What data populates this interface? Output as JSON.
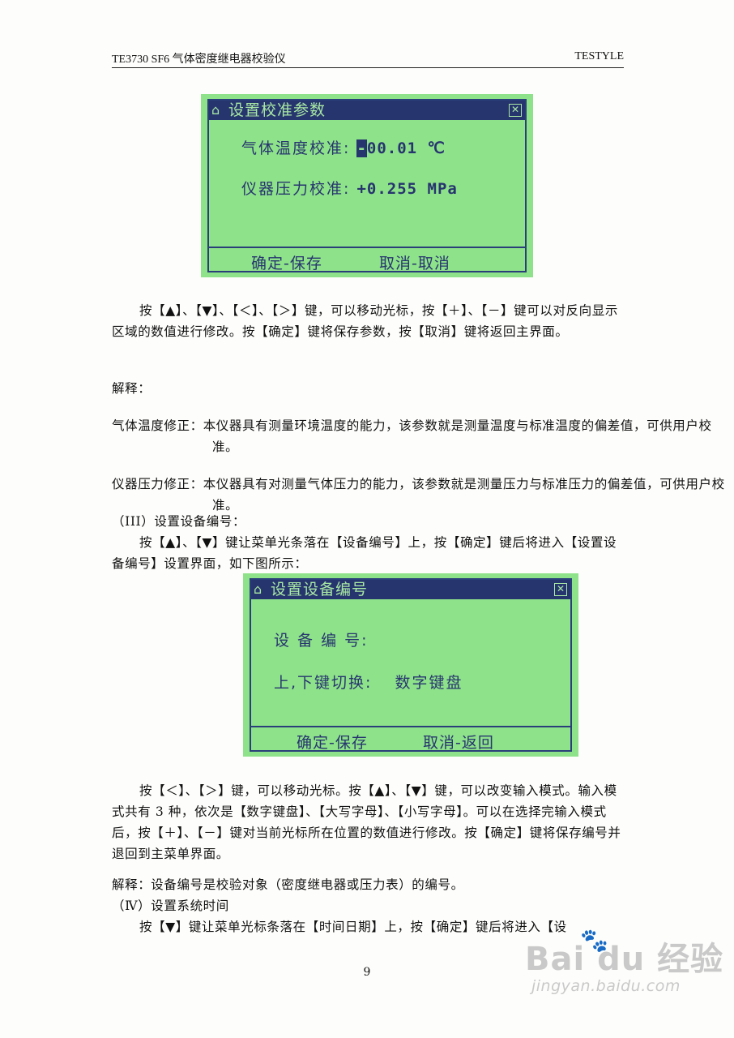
{
  "header": {
    "left": "TE3730 SF6 气体密度继电器校验仪",
    "right": "TESTYLE"
  },
  "screen1": {
    "title": "设置校准参数",
    "temp_label": "气体温度校准:",
    "temp_cursor": "-",
    "temp_value": "00.01 ℃",
    "pressure_label": "仪器压力校准:",
    "pressure_value": "+0.255 MPa",
    "btn_confirm": "确定-保存",
    "btn_cancel": "取消-取消"
  },
  "para1": "按【▲】、【▼】、【＜】、【＞】键，可以移动光标，按【＋】、【－】键可以对反向显示区域的数值进行修改。按【确定】键将保存参数，按【取消】键将返回主界面。",
  "explain_label": "解释：",
  "note_temp": "气体温度修正：本仪器具有测量环境温度的能力，该参数就是测量温度与标准温度的偏差值，可供用户校准。",
  "note_pressure": "仪器压力修正：本仪器具有对测量气体压力的能力，该参数就是测量压力与标准压力的偏差值，可供用户校准。",
  "section3_title": "（III）设置设备编号：",
  "para2": "按【▲】、【▼】键让菜单光条落在【设备编号】上，按【确定】键后将进入【设置设备编号】设置界面，如下图所示：",
  "screen2": {
    "title": "设置设备编号",
    "id_label": "设 备 编 号:",
    "switch_label": "上,下键切换:",
    "switch_value": "数字键盘",
    "btn_confirm": "确定-保存",
    "btn_cancel": "取消-返回"
  },
  "para3": "按【＜】、【＞】键，可以移动光标。按【▲】、【▼】键，可以改变输入模式。输入模式共有 3 种，依次是【数字键盘】、【大写字母】、【小写字母】。可以在选择完输入模式后，按【＋】、【－】键对当前光标所在位置的数值进行修改。按【确定】键将保存编号并退回到主菜单界面。",
  "para4": "解释：设备编号是校验对象（密度继电器或压力表）的编号。",
  "section4_title": "（Ⅳ）设置系统时间",
  "para5": "按【▼】键让菜单光标条落在【时间日期】上，按【确定】键后将进入【设",
  "page_number": "9",
  "watermark": {
    "brand": "Bai du 经验",
    "url": "jingyan.baidu.com"
  }
}
